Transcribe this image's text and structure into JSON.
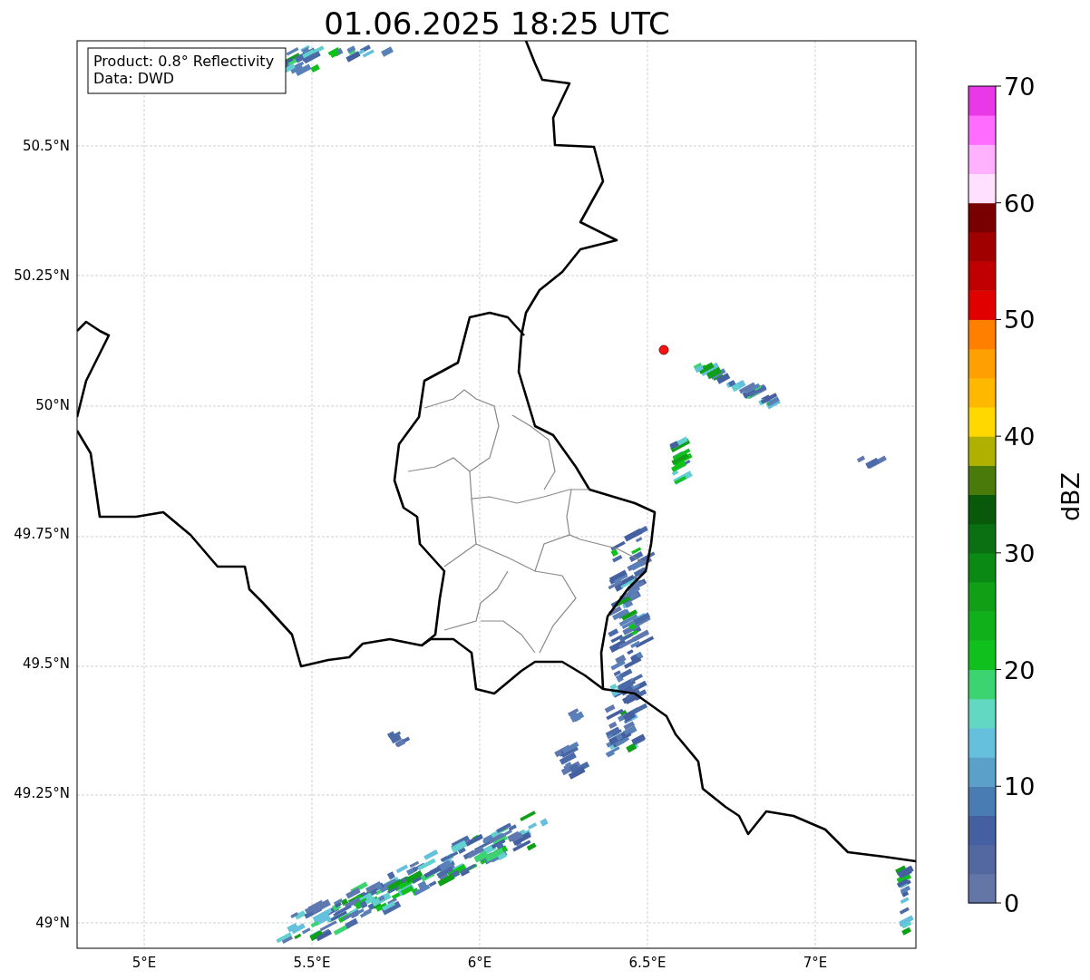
{
  "title": "01.06.2025 18:25 UTC",
  "legend_box": {
    "lines": [
      "Product: 0.8° Reflectivity",
      "Data: DWD"
    ]
  },
  "map": {
    "lat_labels": [
      "50.5°N",
      "50.25°N",
      "50°N",
      "49.75°N",
      "49.5°N",
      "49.25°N",
      "49°N"
    ],
    "lon_labels": [
      "5°E",
      "5.5°E",
      "6°E",
      "6.5°E",
      "7°E"
    ]
  },
  "colorbar": {
    "label": "dBZ",
    "tick_labels": [
      "70",
      "60",
      "50",
      "40",
      "30",
      "20",
      "10",
      "0"
    ],
    "segments": [
      {
        "color": "#6476a8"
      },
      {
        "color": "#5368a0"
      },
      {
        "color": "#4560a0"
      },
      {
        "color": "#4a7cb4"
      },
      {
        "color": "#5aa0c8"
      },
      {
        "color": "#64c0dc"
      },
      {
        "color": "#62d8c2"
      },
      {
        "color": "#3cd470"
      },
      {
        "color": "#10c01c"
      },
      {
        "color": "#10b01a"
      },
      {
        "color": "#10a018"
      },
      {
        "color": "#0a8a14"
      },
      {
        "color": "#0a7012"
      },
      {
        "color": "#085a0a"
      },
      {
        "color": "#4a7a0a"
      },
      {
        "color": "#b0b000"
      },
      {
        "color": "#ffd800"
      },
      {
        "color": "#ffb800"
      },
      {
        "color": "#ff9f00"
      },
      {
        "color": "#ff7f00"
      },
      {
        "color": "#e00000"
      },
      {
        "color": "#c00000"
      },
      {
        "color": "#a00000"
      },
      {
        "color": "#780000"
      },
      {
        "color": "#ffe0ff"
      },
      {
        "color": "#ffb0ff"
      },
      {
        "color": "#ff6cff"
      },
      {
        "color": "#e838e8"
      }
    ]
  }
}
